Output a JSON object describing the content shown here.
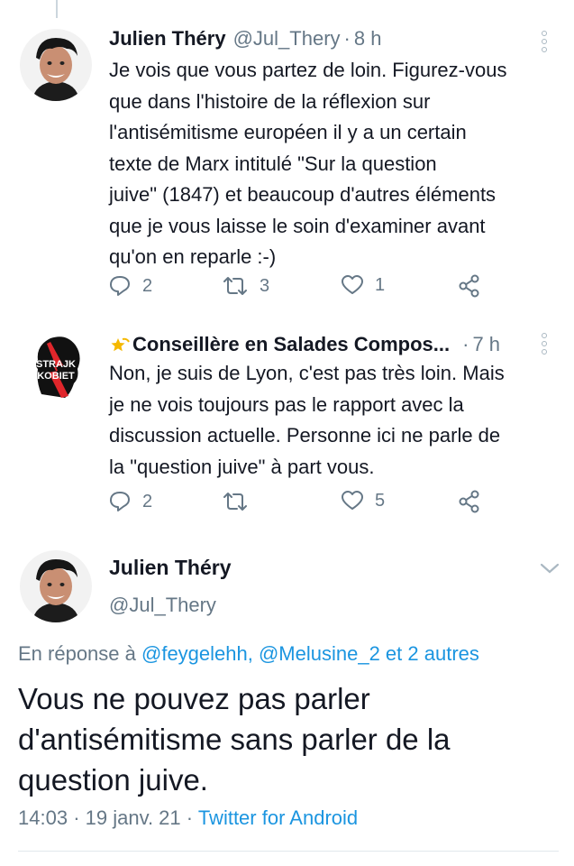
{
  "tweet1": {
    "name": "Julien Théry",
    "handle": "@Jul_Thery",
    "time": "8 h",
    "lines": [
      "Je vois que vous partez de loin. Figurez-vous",
      "que dans l'histoire de la réflexion sur",
      "l'antisémitisme européen il y a un certain",
      "texte de Marx intitulé \"Sur la question",
      "juive\" (1847) et beaucoup d'autres éléments",
      "que je vous laisse le soin d'examiner avant",
      "qu'on en reparle :-)"
    ],
    "replies": "2",
    "retweets": "3",
    "likes": "1",
    "avatar_icon": "man-portrait-avatar"
  },
  "tweet2": {
    "name": "Conseillère en Salades Compos...",
    "time": "7 h",
    "emoji_icon": "dizzy-star-icon",
    "avatar_text_1": "STRAJK",
    "avatar_text_2": "KOBIET",
    "lines": [
      "Non, je suis de Lyon, c'est pas très loin. Mais",
      "je ne vois toujours pas le rapport avec la",
      "discussion actuelle. Personne ici ne parle de",
      "la \"question juive\" à part vous."
    ],
    "replies": "2",
    "likes": "5"
  },
  "focused": {
    "name": "Julien Théry",
    "handle": "@Jul_Thery",
    "reply_prefix": "En réponse à",
    "reply_links": "@feygelehh, @Melusine_2 et 2 autres",
    "lines": [
      "Vous ne pouvez pas parler",
      "d'antisémitisme sans parler de la",
      "question juive."
    ],
    "time": "14:03",
    "date": "19 janv. 21",
    "source": "Twitter for Android"
  },
  "colors": {
    "text": "#141823",
    "muted": "#657786",
    "link": "#1b95e0",
    "avatar_badge_red": "#e0262b"
  }
}
